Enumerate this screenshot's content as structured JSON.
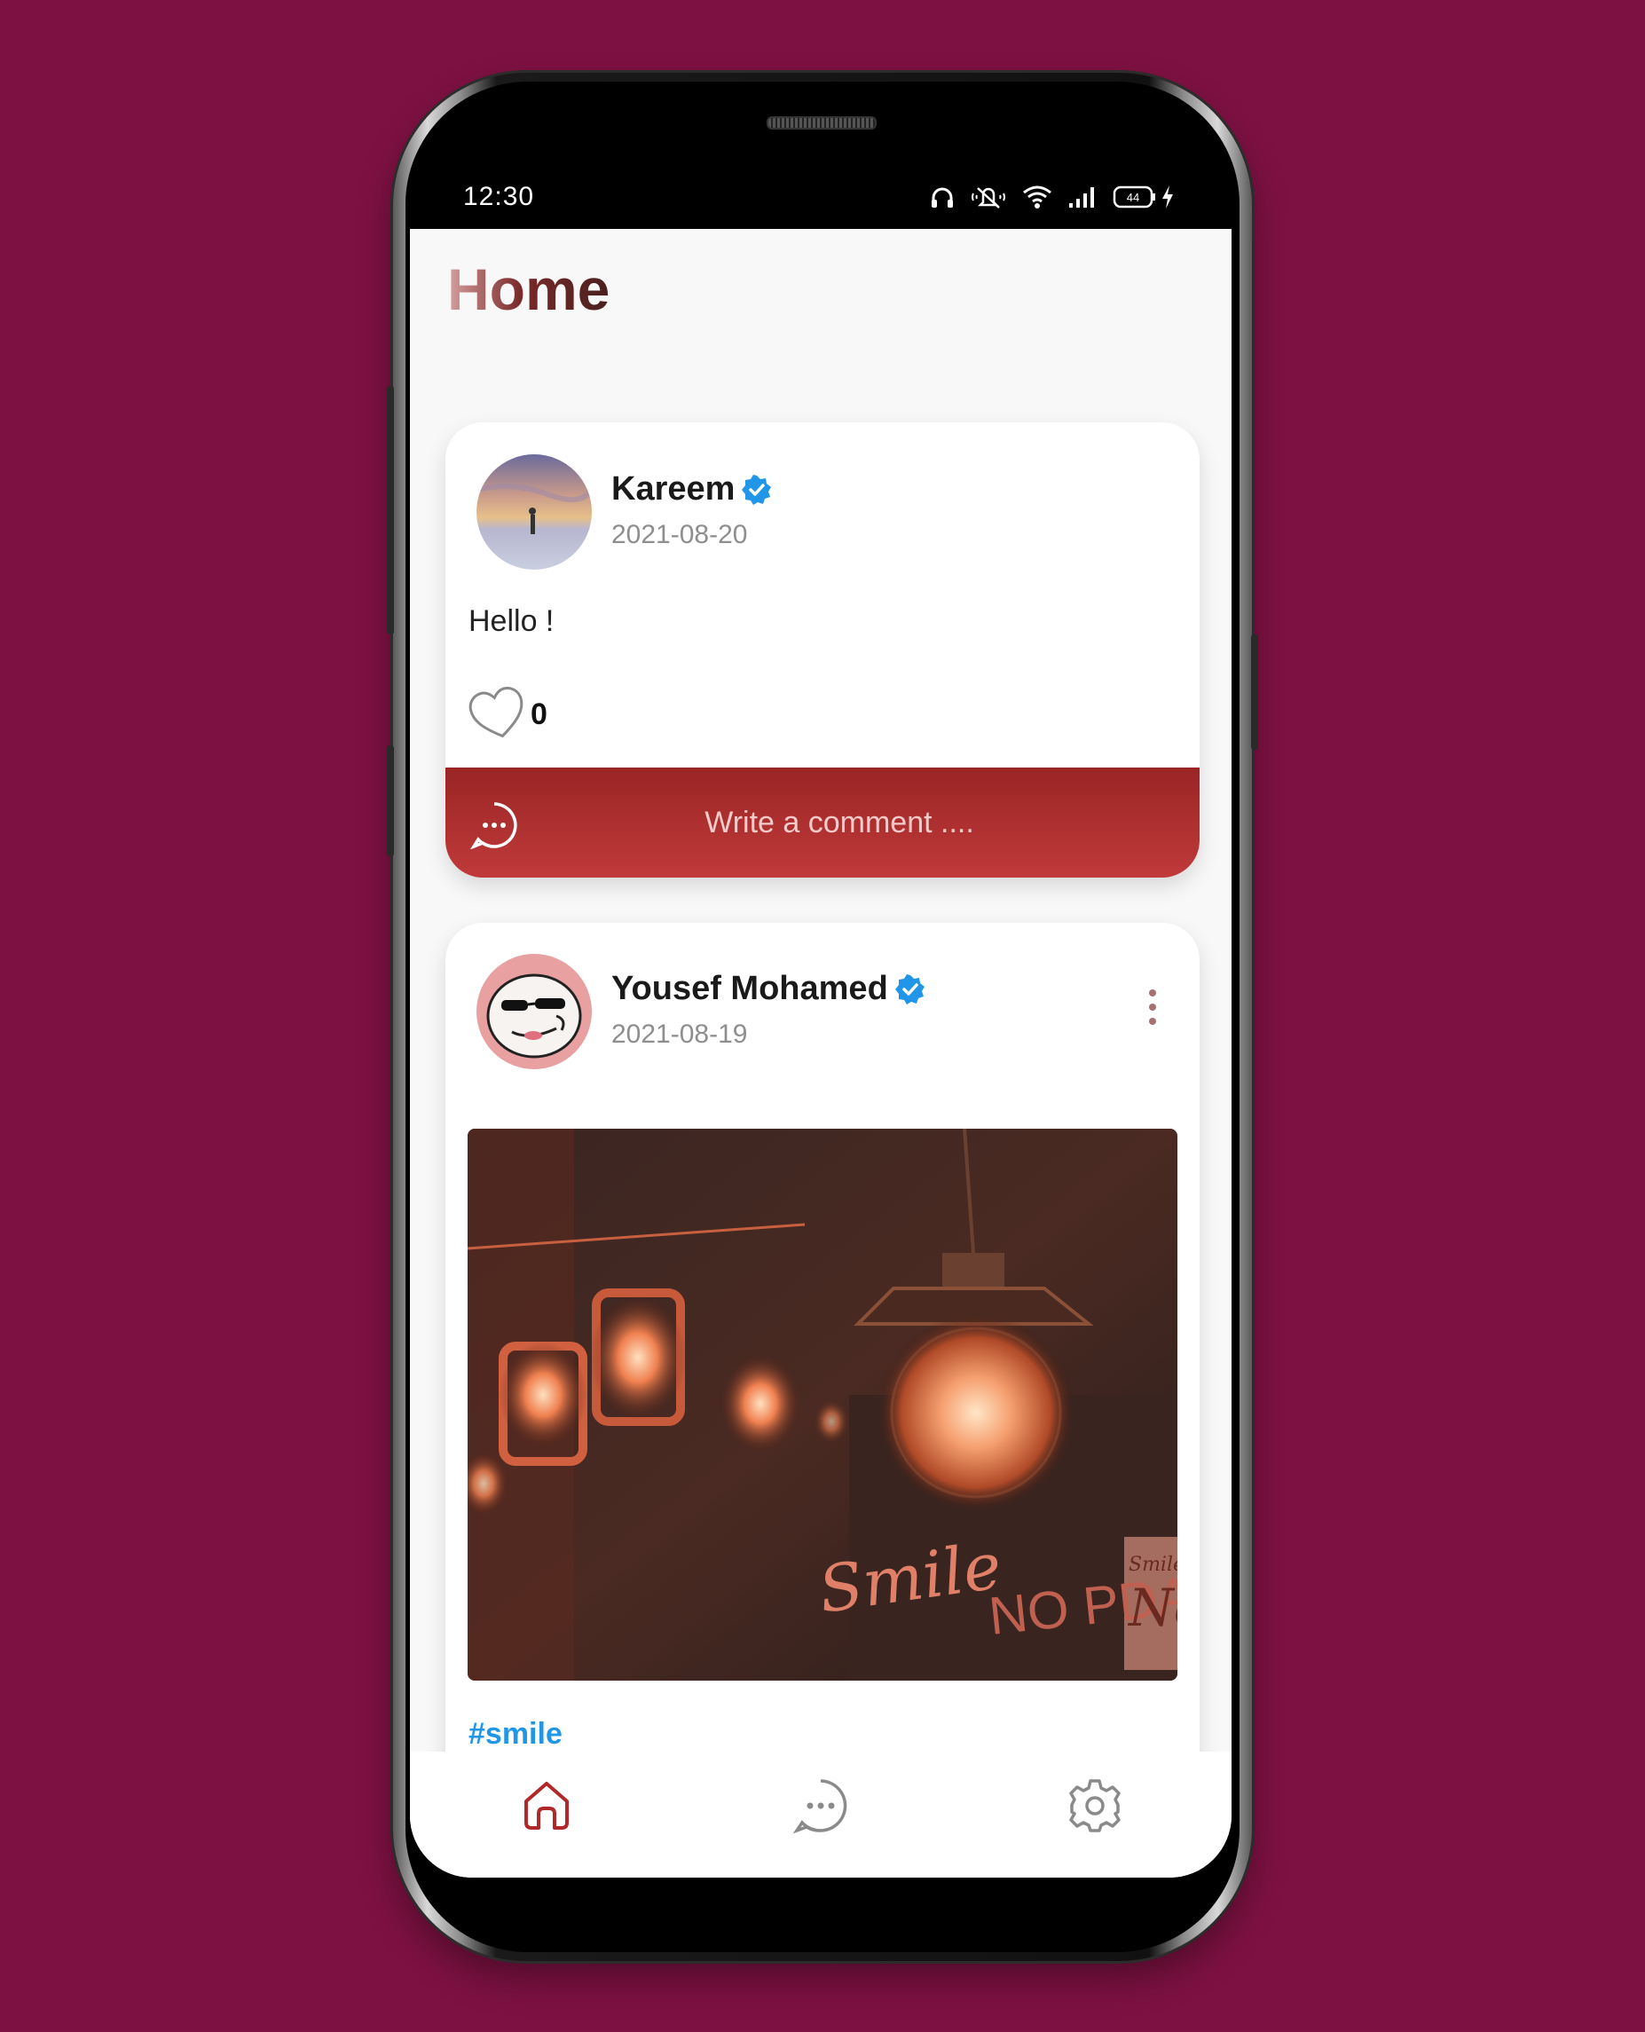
{
  "status_bar": {
    "time": "12:30",
    "battery": "44",
    "icons": [
      "headphones-icon",
      "mute-icon",
      "wifi-icon",
      "signal-icon",
      "battery-icon",
      "charging-icon"
    ]
  },
  "header": {
    "title": "Home"
  },
  "posts": [
    {
      "author": "Kareem",
      "verified": true,
      "date": "2021-08-20",
      "text": "Hello !",
      "likes": "0",
      "comment_placeholder": "Write a comment ...."
    },
    {
      "author": "Yousef Mohamed",
      "verified": true,
      "date": "2021-08-19",
      "image_signs": [
        "Smile",
        "NO PDA",
        "Smile",
        "No"
      ],
      "hashtag": "#smile"
    }
  ],
  "bottom_nav": {
    "items": [
      "home-icon",
      "chat-icon",
      "settings-icon"
    ],
    "active": "home-icon"
  },
  "colors": {
    "background": "#7d1142",
    "accent": "#b03030",
    "verified": "#2196e8",
    "hashtag": "#2196e8"
  }
}
